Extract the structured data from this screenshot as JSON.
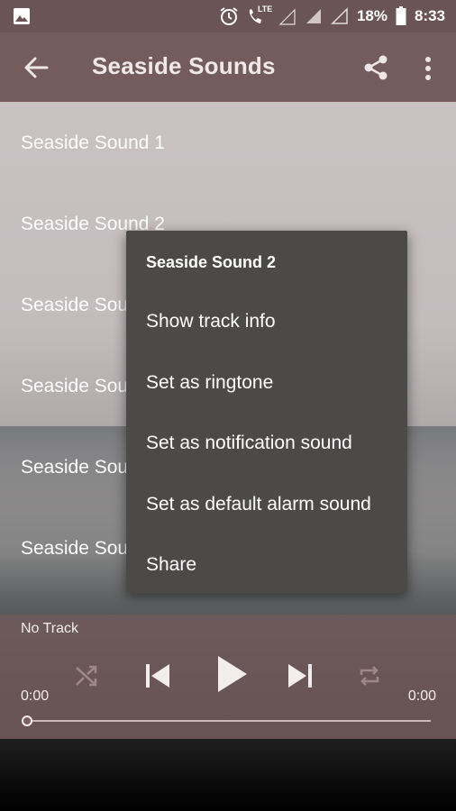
{
  "status_bar": {
    "battery": "18%",
    "time": "8:33",
    "icons": [
      "image-icon",
      "alarm-icon",
      "lte-call-icon",
      "lte-signal-icon",
      "signal-icon",
      "signal-empty-icon",
      "battery-icon"
    ],
    "lte_label": "LTE"
  },
  "app_bar": {
    "title": "Seaside Sounds",
    "icons": [
      "back-arrow-icon",
      "share-icon",
      "more-vert-icon"
    ]
  },
  "tracks": [
    {
      "label": "Seaside Sound 1"
    },
    {
      "label": "Seaside Sound 2"
    },
    {
      "label": "Seaside Sou"
    },
    {
      "label": "Seaside Sou"
    },
    {
      "label": "Seaside Sou"
    },
    {
      "label": "Seaside Sou"
    }
  ],
  "context_menu": {
    "title": "Seaside Sound 2",
    "items": [
      {
        "label": "Show track info"
      },
      {
        "label": "Set as ringtone"
      },
      {
        "label": "Set as notification sound"
      },
      {
        "label": "Set as default alarm sound"
      },
      {
        "label": "Share"
      }
    ]
  },
  "player": {
    "now_playing": "No Track",
    "elapsed": "0:00",
    "duration": "0:00",
    "progress": 0,
    "controls": [
      "shuffle-icon",
      "skip-previous-icon",
      "play-icon",
      "skip-next-icon",
      "repeat-icon"
    ]
  },
  "colors": {
    "status_bar": "#6b5455",
    "app_bar": "#745b5c",
    "menu_bg": "#4b4a47",
    "player_bg": "#735a5c"
  }
}
